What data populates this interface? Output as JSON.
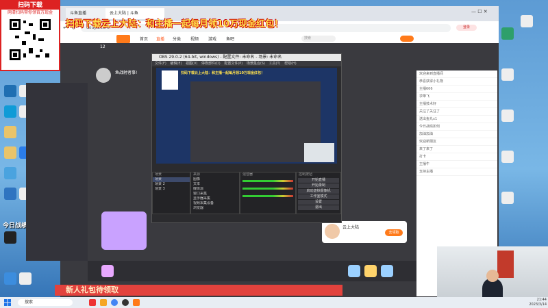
{
  "overlay": {
    "qr_title": "扫码下载",
    "qr_subtitle": "网清扫码带你领百万现金",
    "banner": "扫码下载云上大陆：和主播一起每月领10万现金红包！",
    "today_label": "今日战绩"
  },
  "browser": {
    "tabs": [
      {
        "label": "斗鱼直播"
      },
      {
        "label": "云上大陆 | 斗鱼"
      }
    ],
    "address": "douyu.com",
    "search_placeholder": "搜索",
    "nav": [
      "首页",
      "直播",
      "分类",
      "视频",
      "游戏",
      "鱼吧"
    ],
    "follow_count": "12",
    "login_label": "登录"
  },
  "streamer": {
    "name": "鱼战射者事!",
    "subtitle": "云上大陆"
  },
  "obs": {
    "title": "OBS 29.0.2 (64-bit, windows) - 配置文件: 未命名 - 场景: 未命名",
    "menu": [
      "文件(F)",
      "编辑(E)",
      "视图(V)",
      "停靠部件(D)",
      "配置文件(P)",
      "场景集合(S)",
      "工具(T)",
      "帮助(H)"
    ],
    "docks": {
      "scenes": "场景",
      "sources": "来源",
      "mixer": "混音器",
      "transitions": "转场",
      "controls": "控制按钮"
    },
    "scene_items": [
      "场景",
      "场景 2",
      "场景 3"
    ],
    "source_items": [
      "图像",
      "文本",
      "媒体源",
      "窗口采集",
      "显示器采集",
      "视频采集设备",
      "浏览器"
    ],
    "control_buttons": [
      "开始直播",
      "开始录制",
      "启动虚拟摄像机",
      "工作室模式",
      "设置",
      "退出"
    ],
    "preview_banner": "扫码下载云上大陆：和主播一起每月领10万现金红包！"
  },
  "chat": {
    "lines": [
      "欢迎来到直播间",
      "恭喜获得小礼物",
      "主播666",
      "求带飞",
      "主播技术好",
      "关注了关注了",
      "送出鱼丸x1",
      "今日战绩如何",
      "加油加油",
      "欢迎新朋友",
      "来了来了",
      "打卡",
      "主播牛",
      "支持主播"
    ]
  },
  "bottom": {
    "new_user_banner": "新人礼包待领取",
    "gift_prompt": "去领取"
  },
  "taskbar": {
    "search": "搜索",
    "time": "21:44",
    "date": "2023/3/14"
  },
  "colors": {
    "accent": "#ff5d23",
    "banner_yellow": "#ffe14d",
    "qr_red": "#dd2222"
  }
}
